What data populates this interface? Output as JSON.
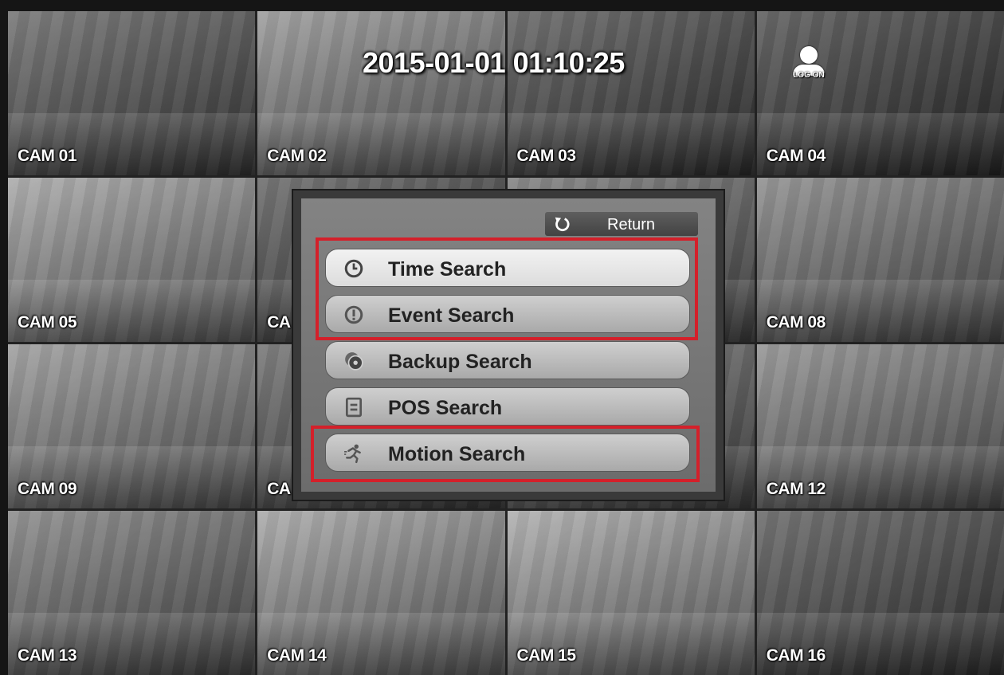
{
  "overlay": {
    "timestamp": "2015-01-01 01:10:25",
    "logon_label": "LOG ON"
  },
  "cameras": [
    {
      "label": "CAM 01"
    },
    {
      "label": "CAM 02"
    },
    {
      "label": "CAM 03"
    },
    {
      "label": "CAM 04"
    },
    {
      "label": "CAM 05"
    },
    {
      "label": "CA"
    },
    {
      "label": ""
    },
    {
      "label": "CAM 08"
    },
    {
      "label": "CAM 09"
    },
    {
      "label": "CA"
    },
    {
      "label": ""
    },
    {
      "label": "CAM 12"
    },
    {
      "label": "CAM 13"
    },
    {
      "label": "CAM 14"
    },
    {
      "label": "CAM 15"
    },
    {
      "label": "CAM 16"
    }
  ],
  "search_menu": {
    "return_label": "Return",
    "items": [
      {
        "label": "Time Search",
        "icon": "clock-icon",
        "selected": true
      },
      {
        "label": "Event Search",
        "icon": "alert-icon",
        "selected": false
      },
      {
        "label": "Backup Search",
        "icon": "backup-icon",
        "selected": false
      },
      {
        "label": "POS Search",
        "icon": "pos-icon",
        "selected": false
      },
      {
        "label": "Motion Search",
        "icon": "motion-icon",
        "selected": false
      }
    ]
  },
  "highlight_color": "#d4202a"
}
